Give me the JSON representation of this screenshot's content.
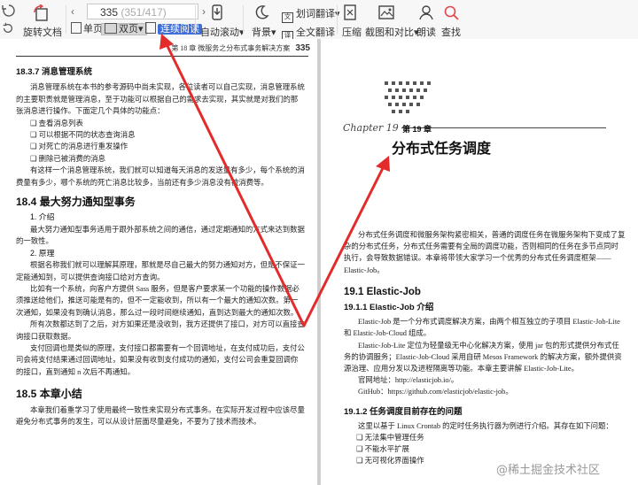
{
  "toolbar": {
    "rotate_doc": "旋转文档",
    "single_page": "单页",
    "double_page": "双页",
    "continuous_read": "连续阅读",
    "auto_scroll": "自动滚动",
    "background": "背景",
    "word_translate": "划词翻译",
    "full_translate": "全文翻译",
    "compress": "压缩",
    "screenshot_compare": "截图和对比",
    "read_aloud": "朗读",
    "search": "查找",
    "page_current": "335",
    "page_total": "(351/417)",
    "dropdown_caret": "▾",
    "accent_color": "#3f6fd6"
  },
  "left_page": {
    "running_head": "第 18 章   微服务之分布式事务解决方案",
    "page_number": "335",
    "sec_1837": "18.3.7  消息管理系统",
    "p1": "消息管理系统在本书的参考源码中尚未实现，各位读者可以自己实现，消息管理系统的主要职责就是管理消息，至于功能可以根据自己的需求去实现，其实就是对我们的那张消息进行操作。下面定几个具体的功能点：",
    "bullets": [
      "查看消息列表",
      "可以根据不同的状态查询消息",
      "对死亡的消息进行重发操作",
      "删除已被消费的消息"
    ],
    "p2": "有这样一个消息管理系统，我们就可以知道每天消息的发送量有多少，每个系统的消费量有多少，哪个系统的死亡消息比较多，当前还有多少消息没有被消费等。",
    "sec_184": "18.4  最大努力通知型事务",
    "h_intro": "1. 介绍",
    "p3": "最大努力通知型事务适用于跟外部系统之间的通信，通过定期通知的方式来达到数据的一致性。",
    "h_principle": "2. 原理",
    "p4": "根据名称我们就可以理解其原理，那就是尽自己最大的努力通知对方，但是不保证一定能通知到，可以提供查询接口给对方查询。",
    "p5": "比如有一个系统，向客户方提供 Sass 服务，但是客户要求某一个功能的操作数据必须推送给他们，推送可能是有的，但不一定能收到，所以有一个最大的通知次数。第一次通知，如果没有到确认消息，那么过一段时间继续通知，直到达到最大的通知次数。",
    "p6": "所有次数都达到了之后，对方如果还是没收到，我方还提供了接口，对方可以直接查询接口获取数据。",
    "p7": "支付回调也是类似的原理，支付接口都需要有一个回调地址，在支付成功后，支付公司会将支付结果通过回调地址，如果没有收到支付成功的通知，支付公司会重复回调你的接口，直到通知 n 次后不再通知。",
    "sec_185": "18.5  本章小结",
    "p8": "本章我们着重学习了使用最终一致性来实现分布式事务。在实际开发过程中应该尽量避免分布式事务的发生，可以从设计层面尽量避免，不要为了技术而技术。"
  },
  "right_page": {
    "chapter_cursive": "Chapter 19",
    "chapter_label": "第 19 章",
    "chapter_title": "分布式任务调度",
    "p1": "分布式任务调度和微服务架构紧密相关，普通的调度任务在微服务架构下变成了复杂的分布式任务，分布式任务需要有全局的调度功能，否则相同的任务在多节点同时执行，会导致数据错误。本章将带领大家学习一个优秀的分布式任务调度框架——Elastic-Job。",
    "sec_191": "19.1  Elastic-Job",
    "sec_1911": "19.1.1  Elastic-Job 介绍",
    "p2": "Elastic-Job 是一个分布式调度解决方案，由两个相互独立的子项目 Elastic-Job-Lite 和 Elastic-Job-Cloud 组成。",
    "p3": "Elastic-Job-Lite 定位为轻量级无中心化解决方案，使用 jar 包的形式提供分布式任务的协调服务；Elastic-Job-Cloud 采用自研 Mesos Framework 的解决方案，额外提供资源治理、应用分发以及进程隔离等功能。本章主要讲解 Elastic-Job-Lite。",
    "official": "官网地址：http://elasticjob.io/。",
    "github": "GitHub：https://github.com/elasticjob/elastic-job。",
    "sec_1912": "19.1.2  任务调度目前存在的问题",
    "p4": "这里以基于 Linux Crontab 的定时任务执行器为例进行介绍。其存在如下问题：",
    "bullets": [
      "无法集中管理任务",
      "不能水平扩展",
      "无可视化界面操作"
    ]
  },
  "watermark": "@稀土掘金技术社区"
}
